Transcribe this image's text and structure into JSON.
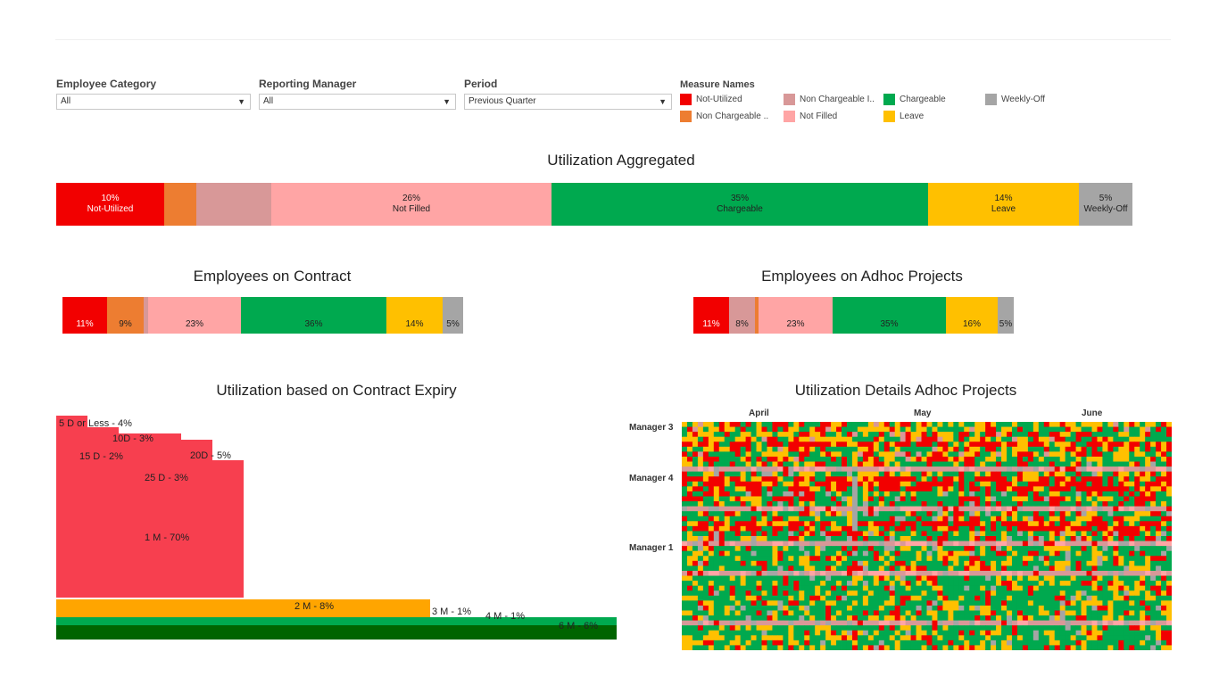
{
  "filters": [
    {
      "label": "Employee Category",
      "value": "All"
    },
    {
      "label": "Reporting Manager",
      "value": "All"
    },
    {
      "label": "Period",
      "value": "Previous Quarter"
    }
  ],
  "legend": {
    "title": "Measure Names",
    "items": [
      {
        "label": "Not-Utilized",
        "color": "#f20000"
      },
      {
        "label": "Non Chargeable ..",
        "color": "#ed7d31"
      },
      {
        "label": "Non Chargeable I..",
        "color": "#d89898"
      },
      {
        "label": "Not Filled",
        "color": "#ffa5a5"
      },
      {
        "label": "Chargeable",
        "color": "#00a94f"
      },
      {
        "label": "Leave",
        "color": "#ffc000"
      },
      {
        "label": "Weekly-Off",
        "color": "#a5a5a5"
      }
    ]
  },
  "chart_data": [
    {
      "type": "bar",
      "title": "Utilization Aggregated",
      "categories": [
        "Not-Utilized",
        "Non Chargeable ..",
        "Non Chargeable I..",
        "Not Filled",
        "Chargeable",
        "Leave",
        "Weekly-Off"
      ],
      "values": [
        10,
        3,
        7,
        26,
        35,
        14,
        5
      ],
      "labels": [
        [
          "10%",
          "Not-Utilized"
        ],
        [],
        [],
        [
          "26%",
          "Not Filled"
        ],
        [
          "35%",
          "Chargeable"
        ],
        [
          "14%",
          "Leave"
        ],
        [
          "5%",
          "Weekly-Off"
        ]
      ],
      "colors": [
        "#f20000",
        "#ed7d31",
        "#d89898",
        "#ffa5a5",
        "#00a94f",
        "#ffc000",
        "#a5a5a5"
      ]
    },
    {
      "type": "bar",
      "title": "Employees on Contract",
      "categories": [
        "Not-Utilized",
        "Non Chargeable ..",
        "Non Chargeable I..",
        "Not Filled",
        "Chargeable",
        "Leave",
        "Weekly-Off"
      ],
      "values": [
        11,
        9,
        1,
        23,
        36,
        14,
        5
      ],
      "labels": [
        "11%",
        "9%",
        "",
        "23%",
        "36%",
        "14%",
        "5%"
      ],
      "colors": [
        "#f20000",
        "#ed7d31",
        "#d89898",
        "#ffa5a5",
        "#00a94f",
        "#ffc000",
        "#a5a5a5"
      ]
    },
    {
      "type": "bar",
      "title": "Employees on Adhoc Projects",
      "categories": [
        "Not-Utilized",
        "Non Chargeable I..",
        "Non Chargeable ..",
        "Not Filled",
        "Chargeable",
        "Leave",
        "Weekly-Off"
      ],
      "values": [
        11,
        8,
        1,
        23,
        35,
        16,
        5
      ],
      "labels": [
        "11%",
        "8%",
        "",
        "23%",
        "35%",
        "16%",
        "5%"
      ],
      "colors": [
        "#f20000",
        "#d89898",
        "#ed7d31",
        "#ffa5a5",
        "#00a94f",
        "#ffc000",
        "#a5a5a5"
      ]
    },
    {
      "type": "bar",
      "title": "Utilization based on Contract Expiry",
      "categories": [
        "5 D or Less",
        "10D",
        "15 D",
        "20D",
        "25 D",
        "1 M",
        "2 M",
        "3 M",
        "4 M",
        "6 M"
      ],
      "values": [
        4,
        3,
        2,
        5,
        3,
        70,
        8,
        1,
        1,
        6
      ],
      "labels": [
        "5 D or Less - 4%",
        "10D - 3%",
        "15 D - 2%",
        "20D - 5%",
        "25 D - 3%",
        "1 M - 70%",
        "2 M - 8%",
        "3 M - 1%",
        "4 M - 1%",
        "6 M - 6%"
      ]
    },
    {
      "type": "heatmap",
      "title": "Utilization Details Adhoc Projects",
      "x_months": [
        "April",
        "May",
        "June"
      ],
      "y_groups": [
        "Manager 3",
        "Manager 4",
        "Manager 1"
      ]
    }
  ]
}
